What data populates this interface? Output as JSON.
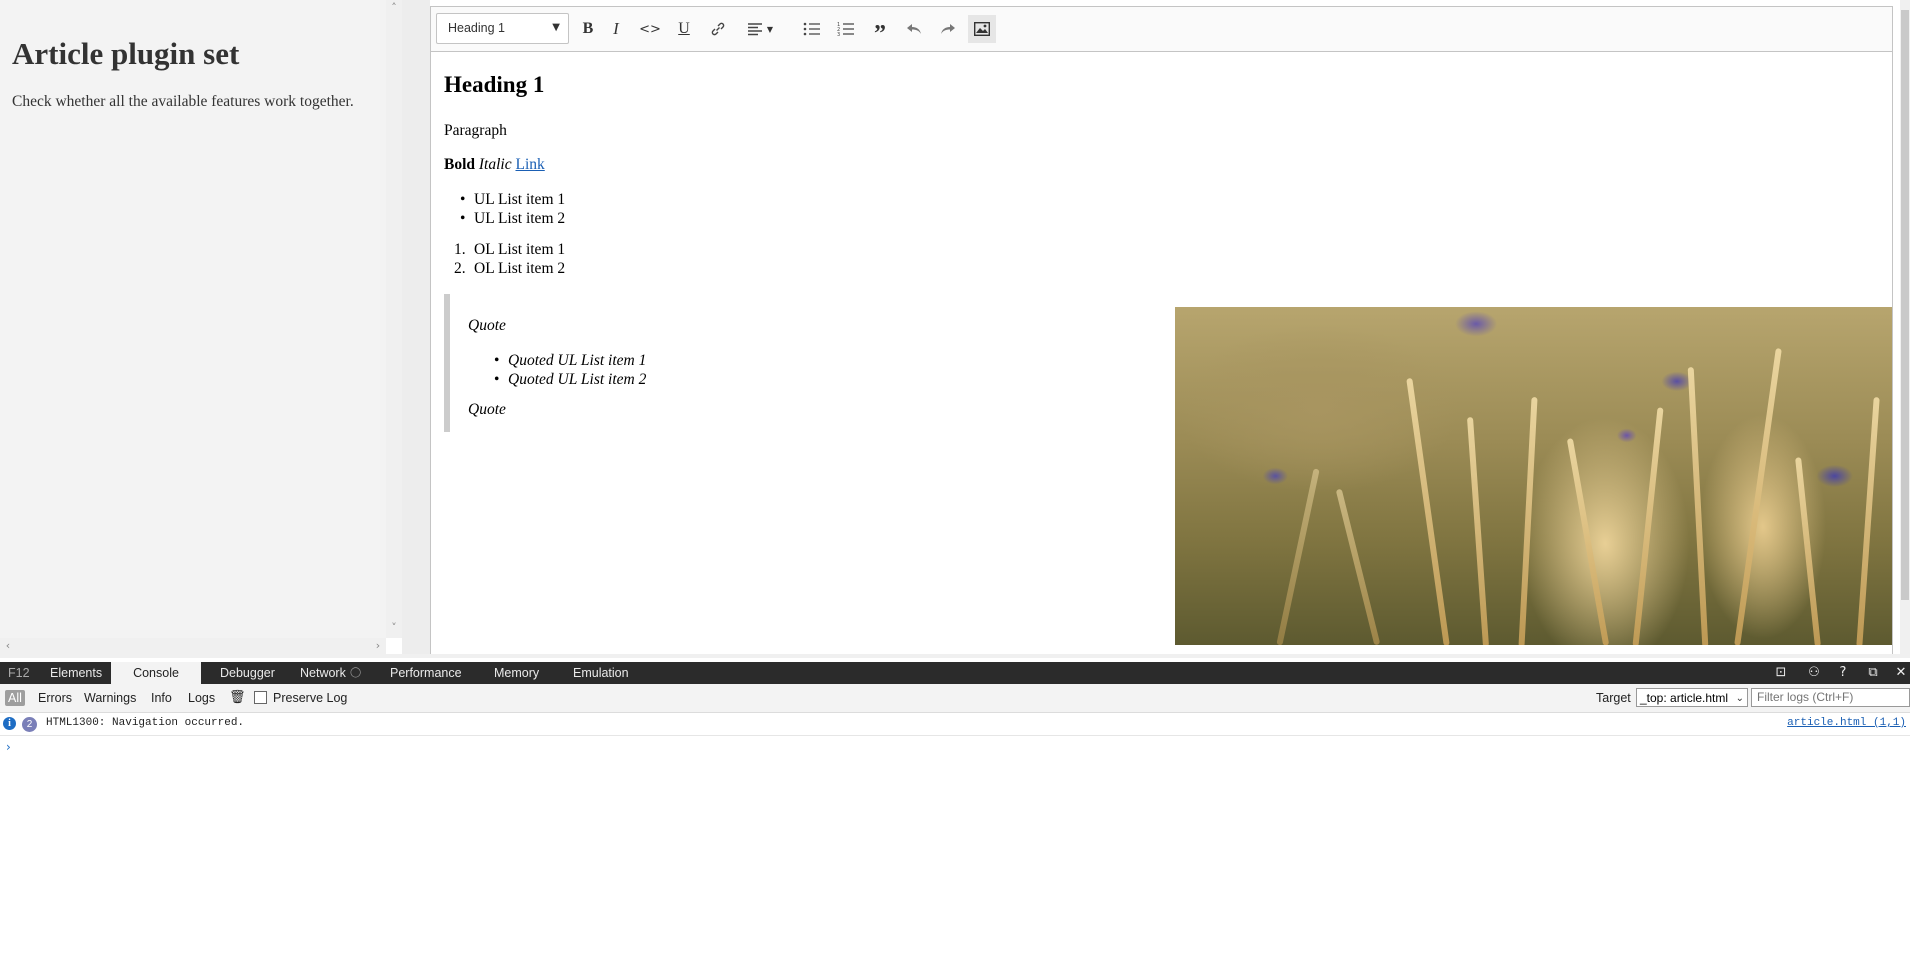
{
  "sidebar": {
    "title": "Article plugin set",
    "description": "Check whether all the available features work together."
  },
  "toolbar": {
    "heading_select": "Heading 1",
    "buttons": [
      "bold-icon",
      "italic-icon",
      "code-icon",
      "underline-icon",
      "link-icon",
      "align-icon",
      "bulleted-list-icon",
      "numbered-list-icon",
      "blockquote-icon",
      "undo-icon",
      "redo-icon",
      "image-icon"
    ]
  },
  "content": {
    "heading": "Heading 1",
    "paragraph": "Paragraph",
    "bold": "Bold",
    "italic": "Italic",
    "link": "Link",
    "ul_items": [
      "UL List item 1",
      "UL List item 2"
    ],
    "ol_items": [
      "OL List item 1",
      "OL List item 2"
    ],
    "ol_numbers": [
      "1.",
      "2."
    ],
    "quote": {
      "text_top": "Quote",
      "items": [
        "Quoted UL List item 1",
        "Quoted UL List item 2"
      ],
      "text_bottom": "Quote"
    }
  },
  "devtools": {
    "f12": "F12",
    "tabs": [
      "Elements",
      "Console",
      "Debugger",
      "Network",
      "Performance",
      "Memory",
      "Emulation"
    ],
    "selected_tab": "Console",
    "filters": [
      "All",
      "Errors",
      "Warnings",
      "Info",
      "Logs"
    ],
    "preserve_log": "Preserve Log",
    "target_label": "Target",
    "target_value": "_top: article.html",
    "filter_placeholder": "Filter logs (Ctrl+F)",
    "message": {
      "icon": "i",
      "count": "2",
      "text": "HTML1300: Navigation occurred.",
      "source": "article.html (1,1)"
    },
    "prompt": "›"
  },
  "colors": {
    "link": "#1a5fb4",
    "devtools_dark": "#2b2b2b",
    "info_blue": "#1e6dc4"
  }
}
